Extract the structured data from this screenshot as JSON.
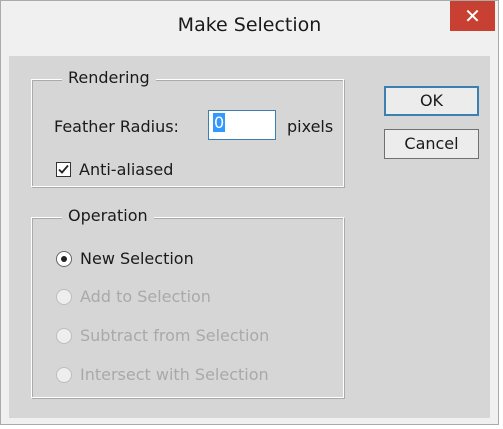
{
  "dialog": {
    "title": "Make Selection",
    "close_glyph": "✕"
  },
  "rendering": {
    "group_label": "Rendering",
    "feather_label": "Feather Radius:",
    "feather_value": "0",
    "feather_unit": "pixels",
    "anti_aliased_label": "Anti-aliased",
    "anti_aliased_checked": true
  },
  "operation": {
    "group_label": "Operation",
    "options": [
      {
        "label": "New Selection",
        "selected": true,
        "enabled": true
      },
      {
        "label": "Add to Selection",
        "selected": false,
        "enabled": false
      },
      {
        "label": "Subtract from Selection",
        "selected": false,
        "enabled": false
      },
      {
        "label": "Intersect with Selection",
        "selected": false,
        "enabled": false
      }
    ]
  },
  "buttons": {
    "ok_label": "OK",
    "cancel_label": "Cancel"
  },
  "colors": {
    "close_button": "#c84031",
    "focus_border": "#3c7fb1",
    "text_selection": "#3399ff",
    "client_background": "#d6d6d6"
  }
}
